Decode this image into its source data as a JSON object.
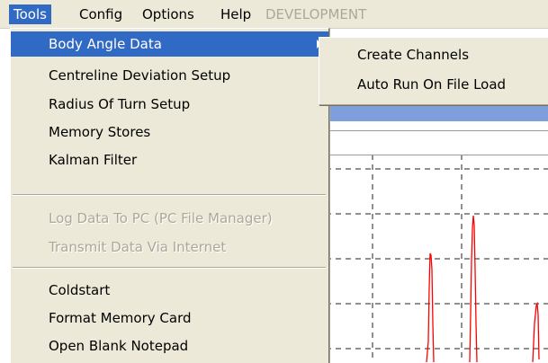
{
  "menubar": {
    "items": [
      {
        "label": "Tools",
        "state": "active"
      },
      {
        "label": "Config",
        "state": "normal"
      },
      {
        "label": "Options",
        "state": "normal"
      },
      {
        "label": "Help",
        "state": "normal"
      },
      {
        "label": "DEVELOPMENT",
        "state": "disabled"
      }
    ]
  },
  "tools_menu": {
    "items": [
      {
        "label": "Body Angle Data",
        "highlighted": true,
        "has_submenu": true
      },
      {
        "label": "Centreline Deviation Setup"
      },
      {
        "label": "Radius Of Turn Setup"
      },
      {
        "label": "Memory Stores"
      },
      {
        "label": "Kalman Filter"
      },
      {
        "label": "Log Data To PC (PC File Manager)",
        "disabled": true
      },
      {
        "label": "Transmit Data Via Internet",
        "disabled": true
      },
      {
        "label": "Coldstart"
      },
      {
        "label": "Format Memory Card"
      },
      {
        "label": "Open Blank Notepad"
      }
    ]
  },
  "submenu": {
    "items": [
      {
        "label": "Create Channels"
      },
      {
        "label": "Auto Run On File Load"
      }
    ]
  },
  "colors": {
    "highlight": "#316ac5",
    "menu_bg": "#ece9d8",
    "disabled_text": "#aca899",
    "trace": "#ff0000"
  }
}
